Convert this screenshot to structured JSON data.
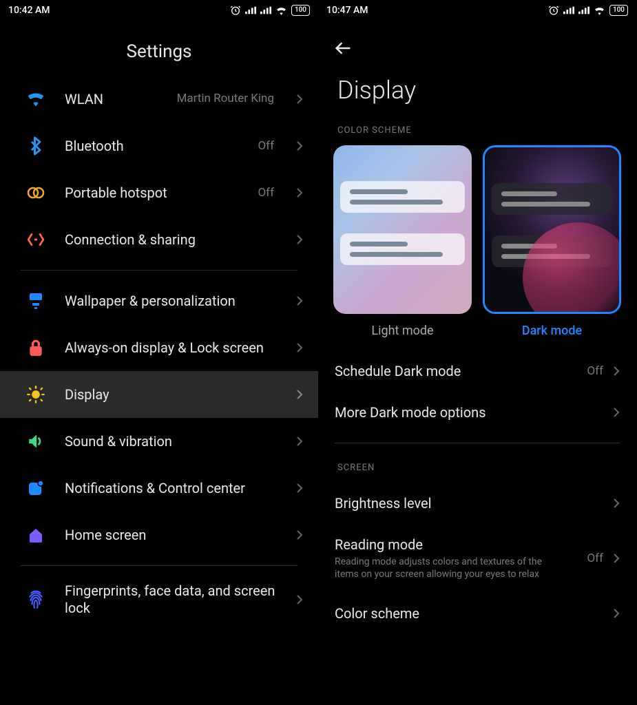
{
  "left": {
    "status_time": "10:42 AM",
    "status_battery": "100",
    "title": "Settings",
    "items": [
      {
        "label": "WLAN",
        "value": "Martin Router King"
      },
      {
        "label": "Bluetooth",
        "value": "Off"
      },
      {
        "label": "Portable hotspot",
        "value": "Off"
      },
      {
        "label": "Connection & sharing",
        "value": ""
      },
      {
        "label": "Wallpaper & personalization",
        "value": ""
      },
      {
        "label": "Always-on display & Lock screen",
        "value": ""
      },
      {
        "label": "Display",
        "value": ""
      },
      {
        "label": "Sound & vibration",
        "value": ""
      },
      {
        "label": "Notifications & Control center",
        "value": ""
      },
      {
        "label": "Home screen",
        "value": ""
      },
      {
        "label": "Fingerprints, face data, and screen lock",
        "value": ""
      }
    ]
  },
  "right": {
    "status_time": "10:47 AM",
    "status_battery": "100",
    "title": "Display",
    "section_color": "COLOR SCHEME",
    "mode_light": "Light mode",
    "mode_dark": "Dark mode",
    "row_schedule": "Schedule Dark mode",
    "row_schedule_value": "Off",
    "row_more": "More Dark mode options",
    "section_screen": "SCREEN",
    "row_brightness": "Brightness level",
    "row_reading": "Reading mode",
    "row_reading_sub": "Reading mode adjusts colors and textures of the items on your screen allowing your eyes to relax",
    "row_reading_value": "Off",
    "row_colorscheme": "Color scheme"
  }
}
